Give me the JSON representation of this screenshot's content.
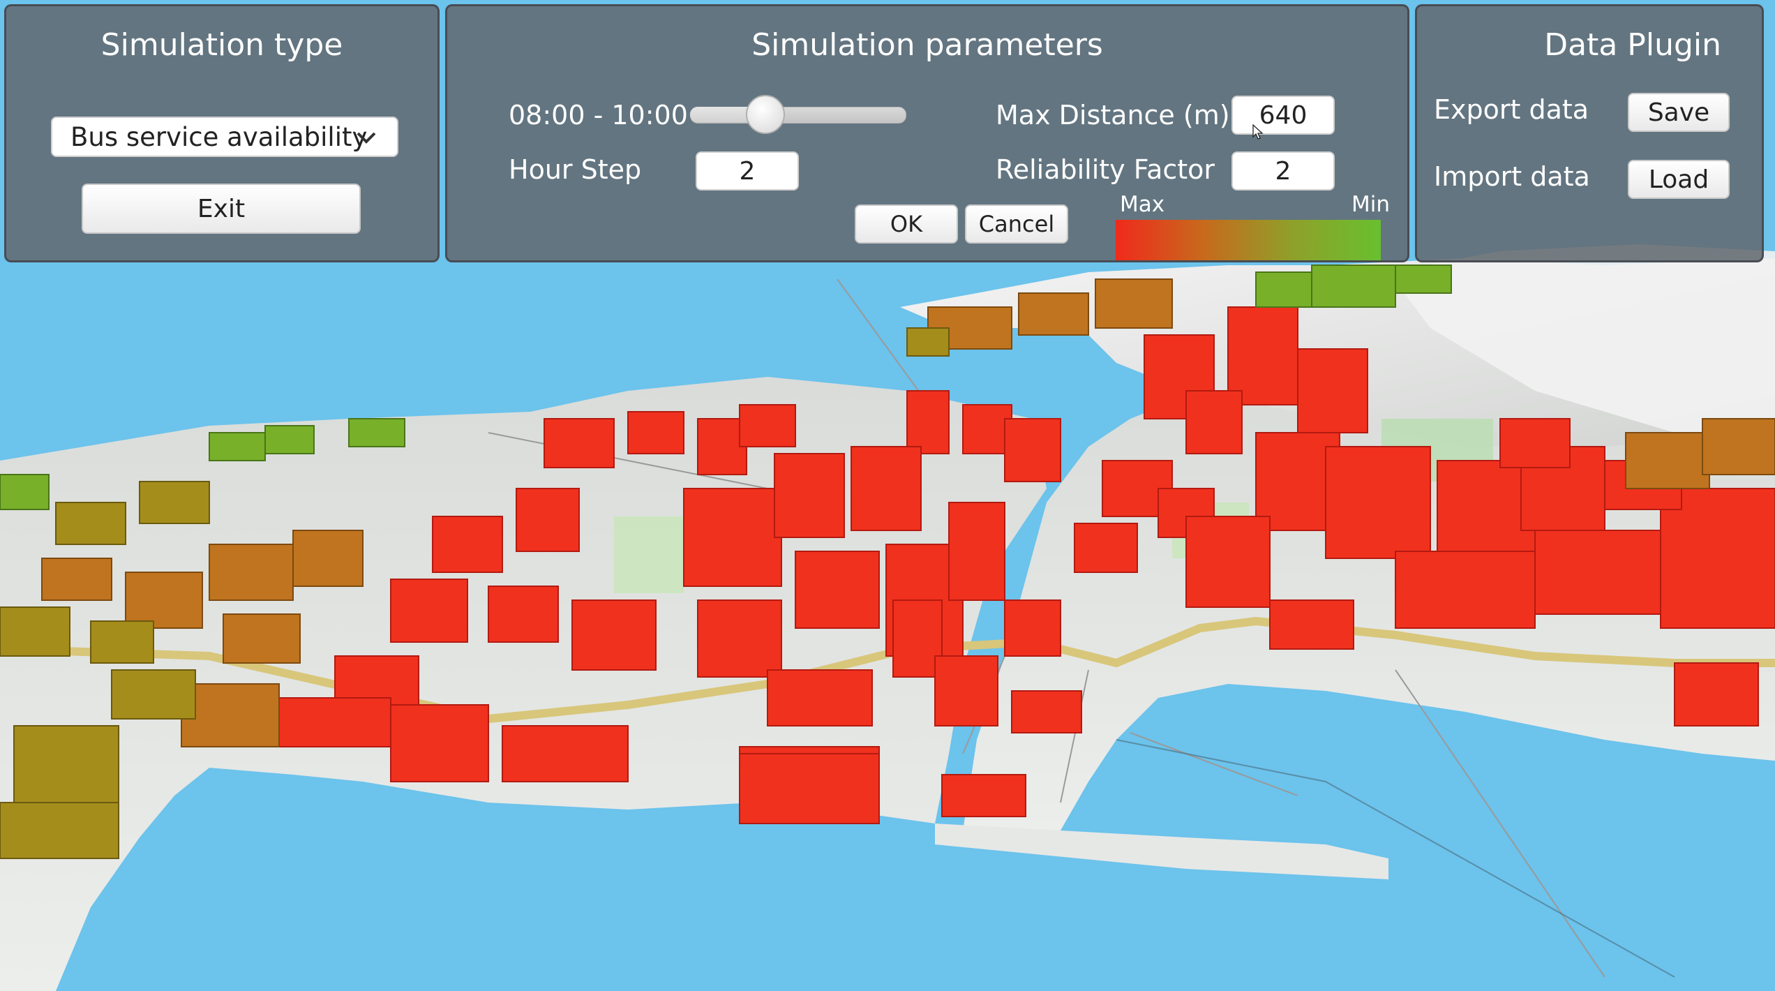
{
  "simulation_type_panel": {
    "title": "Simulation type",
    "dropdown_value": "Bus service availability",
    "exit_label": "Exit"
  },
  "parameters_panel": {
    "title": "Simulation parameters",
    "time_range_label": "08:00 - 10:00",
    "time_slider_value": 0.35,
    "hour_step_label": "Hour Step",
    "hour_step_value": "2",
    "max_distance_label": "Max Distance (m)",
    "max_distance_value": "640",
    "reliability_label": "Reliability Factor",
    "reliability_value": "2",
    "ok_label": "OK",
    "cancel_label": "Cancel",
    "legend_max": "Max",
    "legend_min": "Min"
  },
  "data_plugin_panel": {
    "title": "Data Plugin",
    "export_label": "Export data",
    "save_label": "Save",
    "import_label": "Import data",
    "load_label": "Load"
  },
  "colors": {
    "water": "#6cc3ec",
    "land": "#e6e8e6",
    "max_color": "#f02a1c",
    "mid_color": "#b5821f",
    "min_color": "#68c02f"
  },
  "icons": {
    "dropdown": "chevron-down-icon",
    "cursor": "mouse-pointer-icon"
  }
}
